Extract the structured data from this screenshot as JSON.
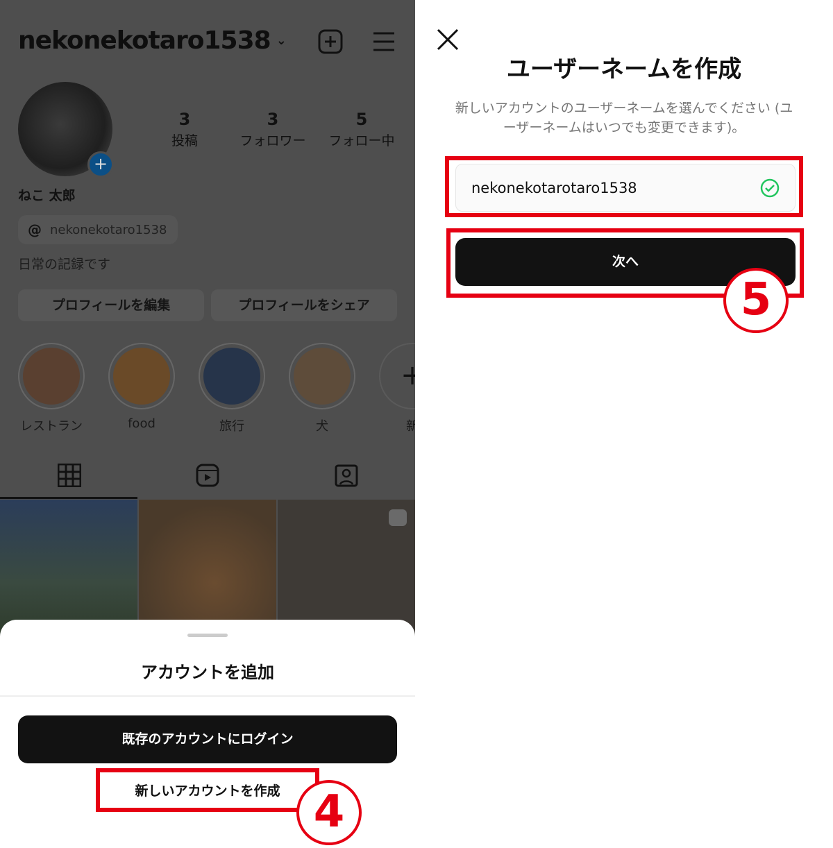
{
  "left": {
    "profile": {
      "username": "nekonekotaro1538",
      "stats": [
        {
          "value": "3",
          "label": "投稿"
        },
        {
          "value": "3",
          "label": "フォロワー"
        },
        {
          "value": "5",
          "label": "フォロー中"
        }
      ],
      "display_name": "ねこ 太郎",
      "threads_handle": "nekonekotaro1538",
      "bio": "日常の記録です",
      "edit_button": "プロフィールを編集",
      "share_button": "プロフィールをシェア",
      "highlights": [
        {
          "label": "レストラン",
          "color": "#6b4a2e"
        },
        {
          "label": "food",
          "color": "#7a5a30"
        },
        {
          "label": "旅行",
          "color": "#2e3c52"
        },
        {
          "label": "犬",
          "color": "#6e5a44"
        },
        {
          "label": "新"
        }
      ]
    },
    "sheet": {
      "title": "アカウントを追加",
      "login_button": "既存のアカウントにログイン",
      "create_link": "新しいアカウントを作成",
      "step_number": "4"
    }
  },
  "right": {
    "title": "ユーザーネームを作成",
    "description": "新しいアカウントのユーザーネームを選んでください (ユーザーネームはいつでも変更できます)。",
    "username_value": "nekonekotarotaro1538",
    "next_button": "次へ",
    "step_number": "5",
    "colors": {
      "valid": "#22c55e",
      "annotation": "#e60012"
    }
  }
}
